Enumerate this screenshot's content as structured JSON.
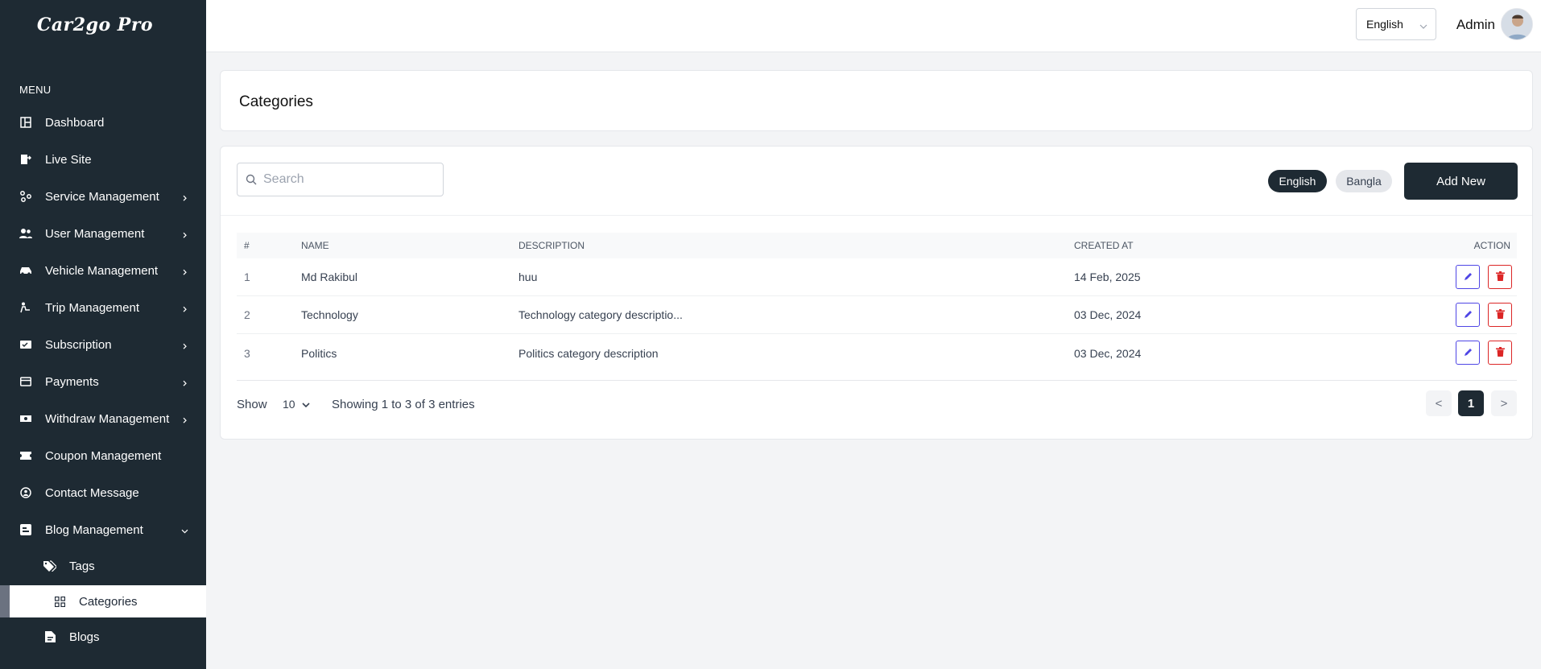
{
  "app": {
    "logo": "Car2go Pro"
  },
  "sidebar": {
    "menu_label": "MENU",
    "items": [
      {
        "label": "Dashboard",
        "icon": "dashboard-icon"
      },
      {
        "label": "Live Site",
        "icon": "live-site-icon"
      },
      {
        "label": "Service Management",
        "icon": "service-icon"
      },
      {
        "label": "User Management",
        "icon": "users-icon"
      },
      {
        "label": "Vehicle Management",
        "icon": "car-icon"
      },
      {
        "label": "Trip Management",
        "icon": "trip-icon"
      },
      {
        "label": "Subscription",
        "icon": "subscription-icon"
      },
      {
        "label": "Payments",
        "icon": "card-icon"
      },
      {
        "label": "Withdraw Management",
        "icon": "cash-icon"
      },
      {
        "label": "Coupon Management",
        "icon": "ticket-icon"
      },
      {
        "label": "Contact Message",
        "icon": "contact-icon"
      },
      {
        "label": "Blog Management",
        "icon": "blog-icon"
      },
      {
        "label": "Tags",
        "icon": "tags-icon"
      },
      {
        "label": "Categories",
        "icon": "grid-icon"
      },
      {
        "label": "Blogs",
        "icon": "document-icon"
      }
    ]
  },
  "topbar": {
    "language": "English",
    "user": "Admin"
  },
  "page": {
    "title": "Categories"
  },
  "toolbar": {
    "search_placeholder": "Search",
    "lang_english": "English",
    "lang_bangla": "Bangla",
    "add_label": "Add New"
  },
  "table": {
    "headers": [
      "#",
      "NAME",
      "DESCRIPTION",
      "CREATED AT",
      "ACTION"
    ],
    "rows": [
      {
        "num": "1",
        "name": "Md Rakibul",
        "description": "huu",
        "created": "14 Feb, 2025"
      },
      {
        "num": "2",
        "name": "Technology",
        "description": "Technology category descriptio...",
        "created": "03 Dec, 2024"
      },
      {
        "num": "3",
        "name": "Politics",
        "description": "Politics category description",
        "created": "03 Dec, 2024"
      }
    ]
  },
  "pagination": {
    "show_label": "Show",
    "per_page": "10",
    "entries_text": "Showing 1 to 3 of 3 entries",
    "prev": "<",
    "current": "1",
    "next": ">"
  },
  "colors": {
    "sidebar": "#1e2a33",
    "edit": "#4f46e5",
    "delete": "#dc2626"
  }
}
